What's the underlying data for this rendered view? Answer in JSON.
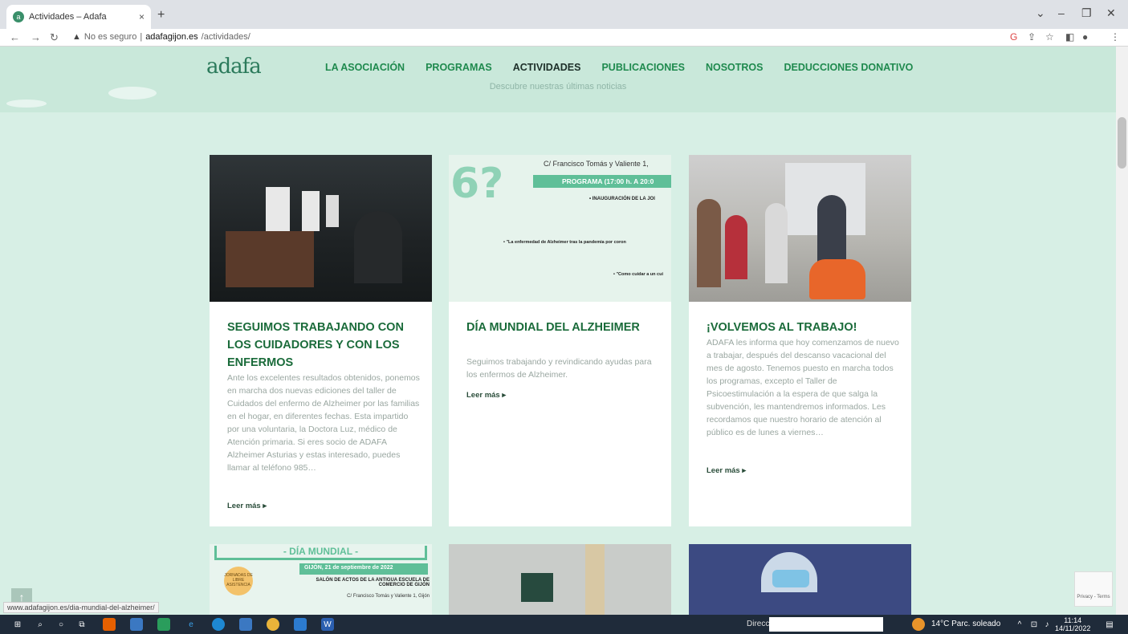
{
  "browser": {
    "tab_title": "Actividades – Adafa",
    "tab_close": "×",
    "new_tab": "+",
    "security": "No es seguro",
    "url_host": "adafagijon.es",
    "url_path": "/actividades/"
  },
  "site": {
    "logo": "adafa",
    "nav": [
      "LA ASOCIACIÓN",
      "PROGRAMAS",
      "ACTIVIDADES",
      "PUBLICACIONES",
      "NOSOTROS",
      "DEDUCCIONES DONATIVO"
    ],
    "tagline": "Descubre nuestras últimas noticias"
  },
  "cards": [
    {
      "title": "SEGUIMOS TRABAJANDO CON LOS CUIDADORES Y CON LOS ENFERMOS",
      "excerpt": "Ante los excelentes resultados obtenidos, ponemos en marcha dos nuevas ediciones del taller de Cuidados del enfermo de Alzheimer por las familias en el hogar, en diferentes fechas. Esta impartido por una voluntaria, la Doctora Luz, médico de Atención primaria. Si eres socio de ADAFA Alzheimer Asturias y estas interesado, puedes llamar al teléfono 985…",
      "more": "Leer más ▸"
    },
    {
      "title": "DÍA MUNDIAL DEL ALZHEIMER",
      "excerpt": "Seguimos trabajando y revindicando ayudas para los enfermos de Alzheimer.",
      "more": "Leer más ▸",
      "poster": {
        "address": "C/ Francisco Tomás y Valiente 1,",
        "program": "PROGRAMA (17:00 h. A 20:0",
        "line1": "• INAUGURACIÓN DE LA JOI",
        "line2": "• \"La enfermedad de Alzheimer tras la pandemia por coron",
        "line3": "• \"Como cuidar a un cui"
      }
    },
    {
      "title": "¡VOLVEMOS AL TRABAJO!",
      "excerpt": "ADAFA les informa que hoy comenzamos de nuevo a trabajar, después del descanso vacacional del mes de agosto. Tenemos puesto en marcha todos los programas, excepto el Taller de Psicoestimulación a la espera de que salga la subvención, les mantendremos informados. Les recordamos que nuestro horario de atención al público es de lunes a viernes…",
      "more": "Leer más ▸"
    }
  ],
  "bottom_poster": {
    "title": "- DÍA MUNDIAL -",
    "date": "GIJÓN, 21 de septiembre de 2022",
    "venue": "SALÓN DE ACTOS DE LA ANTIGUA ESCUELA DE COMERCIO DE GIJÓN",
    "address": "C/ Francisco Tomás y Valiente 1, Gijón",
    "badge": "JORNADAS DE LIBRE ASISTENCIA"
  },
  "status_url": "www.adafagijon.es/dia-mundial-del-alzheimer/",
  "recaptcha": "Privacy - Terms",
  "taskbar": {
    "direccion": "Dirección",
    "weather": "14°C  Parc. soleado",
    "time": "11:14",
    "date": "14/11/2022"
  },
  "colors": {
    "accent_green": "#1f8a4e",
    "title_green": "#1a6b3a",
    "page_bg": "#d7efe5"
  }
}
